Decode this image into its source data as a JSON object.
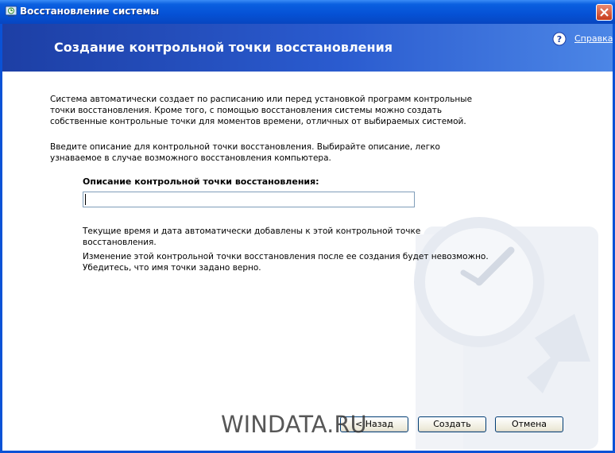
{
  "window": {
    "title": "Восстановление системы"
  },
  "header": {
    "page_title": "Создание контрольной точки восстановления",
    "help_label": "Справка"
  },
  "main": {
    "paragraph1": "Система автоматически создает по расписанию или перед установкой программ контрольные точки восстановления. Кроме того, с помощью восстановления системы можно создать собственные контрольные точки для моментов времени, отличных от выбираемых системой.",
    "paragraph2": "Введите описание для контрольной точки восстановления. Выбирайте описание, легко узнаваемое в случае возможного восстановления компьютера.",
    "description_label": "Описание контрольной точки восстановления:",
    "description_value": "",
    "paragraph3": "Текущие время и дата автоматически добавлены к этой контрольной точке восстановления.",
    "paragraph4": "Изменение этой контрольной точки восстановления после ее создания будет невозможно. Убедитесь, что имя точки задано верно."
  },
  "buttons": {
    "back": "< Назад",
    "create": "Создать",
    "cancel": "Отмена"
  },
  "watermark_text": "WINDATA.RU",
  "icons": {
    "title": "system-restore-icon",
    "close": "close-icon",
    "help": "help-icon",
    "background": "clock-arrow-icon"
  },
  "colors": {
    "titlebar": "#0551d5",
    "header": "#2a5bcf",
    "close": "#c73c1c"
  }
}
